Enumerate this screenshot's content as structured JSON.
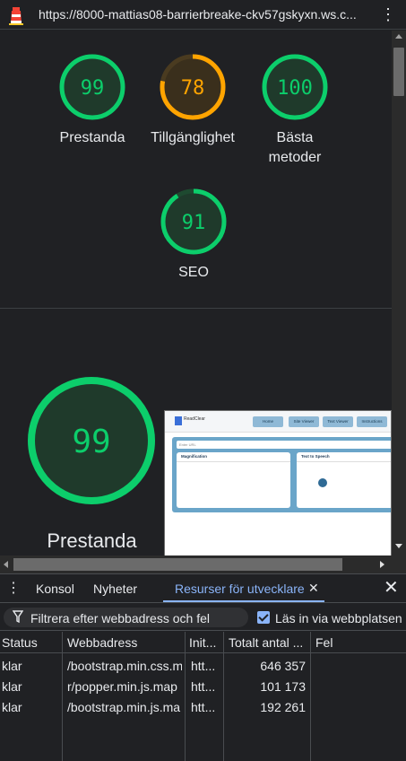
{
  "window": {
    "url": "https://8000-mattias08-barrierbreake-ckv57gskyxn.ws.c...",
    "menu_icon": "kebab-vertical-icon"
  },
  "report": {
    "gauges": [
      {
        "score": "99",
        "label": "Prestanda",
        "status": "pass",
        "color": "#0cce6b"
      },
      {
        "score": "78",
        "label": "Tillgänglighet",
        "status": "average",
        "color": "#ffa400"
      },
      {
        "score": "100",
        "label_line1": "Bästa",
        "label_line2": "metoder",
        "status": "pass",
        "color": "#0cce6b"
      },
      {
        "score": "91",
        "label": "SEO",
        "status": "pass",
        "color": "#0cce6b"
      }
    ],
    "big_gauge": {
      "score": "99",
      "label": "Prestanda",
      "color": "#0cce6b"
    },
    "screenshot": {
      "logo_text": "ReadClear",
      "nav": [
        "Home",
        "Site Viewer",
        "Text Viewer",
        "Instructions"
      ],
      "input_placeholder": "Enter URL",
      "card1_title": "Magnification",
      "card2_title": "Text to Speech"
    }
  },
  "devtools": {
    "tabs": [
      {
        "label": "Konsol",
        "active": false
      },
      {
        "label": "Nyheter",
        "active": false
      },
      {
        "label": "Resurser för utvecklare",
        "active": true
      }
    ],
    "accent": "#8ab4f8",
    "filter_placeholder": "Filtrera efter webbadress och fel",
    "checkbox_label": "Läs in via webbplatsen",
    "checkbox_checked": true,
    "columns": [
      "Status",
      "Webbadress",
      "Init...",
      "Totalt antal ...",
      "Fel"
    ],
    "rows": [
      {
        "status": "klar",
        "url": "/bootstrap.min.css.m",
        "init": "htt...",
        "total": "646 357",
        "error": ""
      },
      {
        "status": "klar",
        "url": "r/popper.min.js.map",
        "init": "htt...",
        "total": "101 173",
        "error": ""
      },
      {
        "status": "klar",
        "url": "/bootstrap.min.js.ma",
        "init": "htt...",
        "total": "192 261",
        "error": ""
      }
    ]
  }
}
